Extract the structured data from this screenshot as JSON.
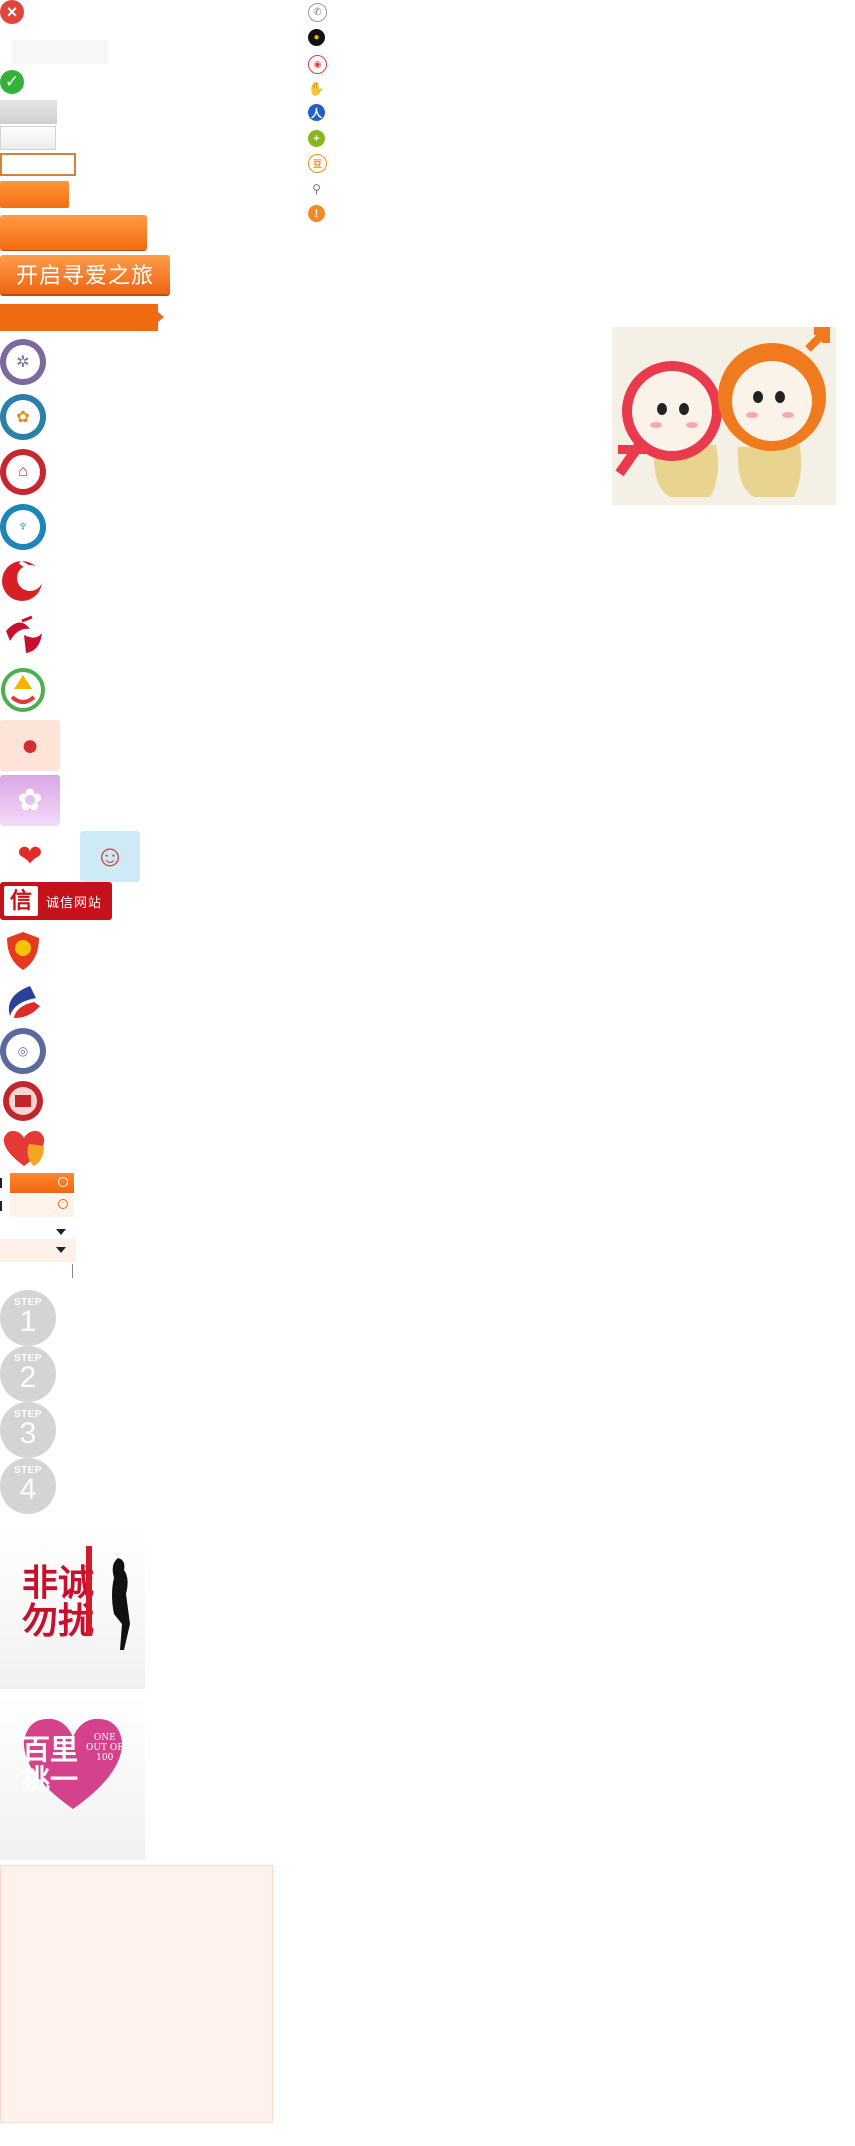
{
  "sprites": {
    "close_glyph": "×",
    "check_glyph": "✓",
    "start_button_label": "开启寻爱之旅"
  },
  "social_icons": [
    "phone-icon",
    "qq-icon",
    "weibo-icon",
    "baidu-icon",
    "renren-icon",
    "kaixin-icon",
    "douban-icon",
    "search-icon",
    "info-icon"
  ],
  "badges": {
    "trust_badge_label": "诚信网站",
    "trust_badge_char": "信"
  },
  "steps": [
    {
      "word": "STEP",
      "number": "1"
    },
    {
      "word": "STEP",
      "number": "2"
    },
    {
      "word": "STEP",
      "number": "3"
    },
    {
      "word": "STEP",
      "number": "4"
    }
  ],
  "posters": [
    {
      "title": "非诚勿扰"
    },
    {
      "title": "百里挑一",
      "subtitle_line1": "ONE",
      "subtitle_line2": "OUT OF",
      "subtitle_line3": "100"
    }
  ],
  "colors": {
    "brand_orange": "#f36d14",
    "close_red": "#e0453a",
    "check_green": "#33b23a",
    "trust_red": "#c5121a"
  }
}
